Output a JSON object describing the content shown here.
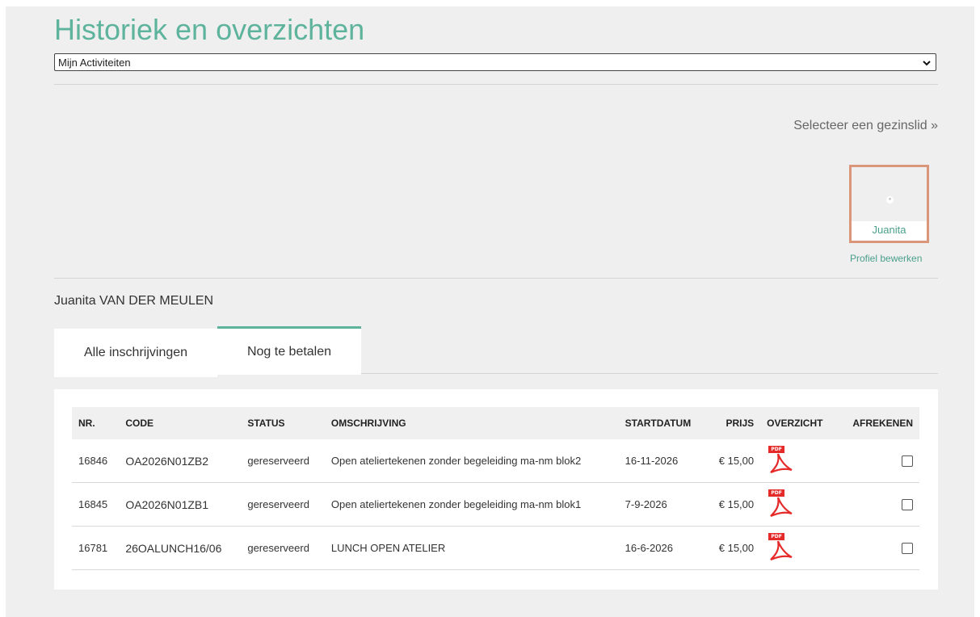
{
  "page_title": "Historiek en overzichten",
  "view_select": {
    "value": "Mijn Activiteiten"
  },
  "family": {
    "select_label": "Selecteer een gezinslid »",
    "member_name": "Juanita",
    "edit_profile": "Profiel bewerken",
    "full_name": "Juanita VAN DER MEULEN"
  },
  "tabs": [
    {
      "label": "Alle inschrijvingen",
      "active": false
    },
    {
      "label": "Nog te betalen",
      "active": true
    }
  ],
  "table": {
    "headers": {
      "nr": "NR.",
      "code": "CODE",
      "status": "STATUS",
      "omschrijving": "OMSCHRIJVING",
      "startdatum": "STARTDATUM",
      "prijs": "PRIJS",
      "overzicht": "OVERZICHT",
      "afrekenen": "AFREKENEN"
    },
    "rows": [
      {
        "nr": "16846",
        "code": "OA2026N01ZB2",
        "status": "gereserveerd",
        "omschrijving": "Open ateliertekenen zonder begeleiding ma-nm blok2",
        "startdatum": "16-11-2026",
        "prijs": "€ 15,00",
        "checked": false
      },
      {
        "nr": "16845",
        "code": "OA2026N01ZB1",
        "status": "gereserveerd",
        "omschrijving": "Open ateliertekenen zonder begeleiding ma-nm blok1",
        "startdatum": "7-9-2026",
        "prijs": "€ 15,00",
        "checked": false
      },
      {
        "nr": "16781",
        "code": "26OALUNCH16/06",
        "status": "gereserveerd",
        "omschrijving": "LUNCH OPEN ATELIER",
        "startdatum": "16-6-2026",
        "prijs": "€ 15,00",
        "checked": false
      }
    ]
  },
  "icons": {
    "pdf_tag": "PDF",
    "pdf_color": "#e52a2a",
    "accent": "#5db39b",
    "card_border": "#d9967a"
  }
}
